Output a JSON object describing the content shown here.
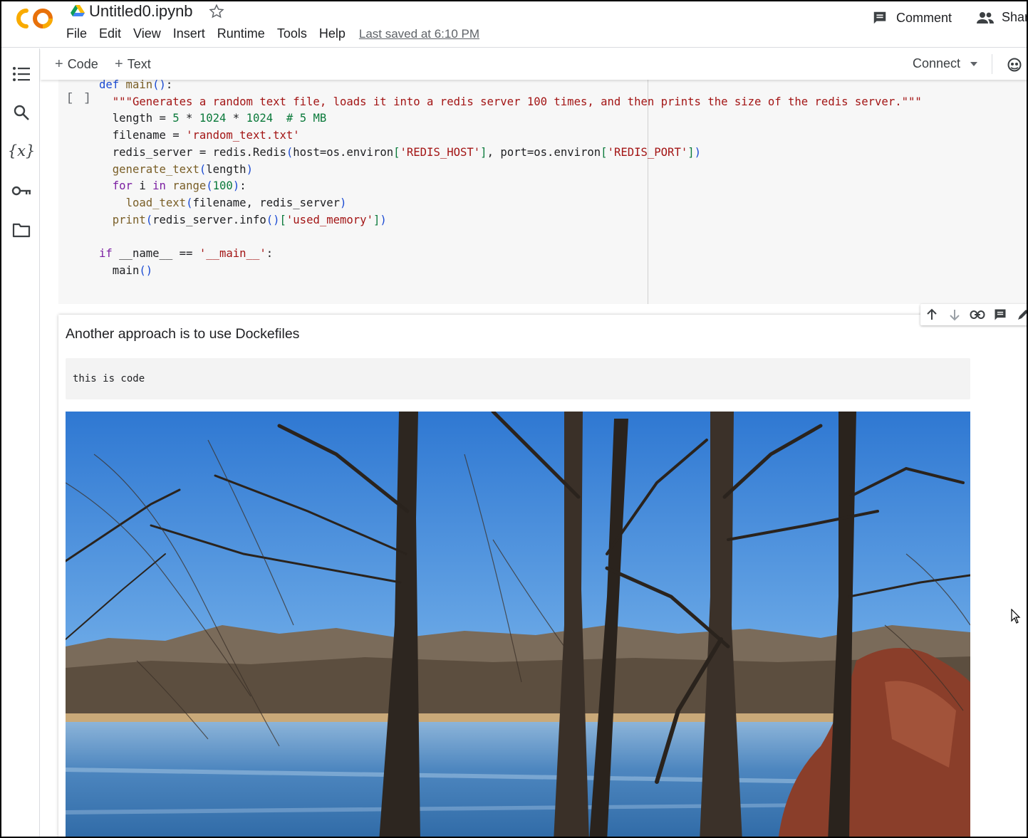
{
  "header": {
    "doc_title": "Untitled0.ipynb",
    "menu": [
      "File",
      "Edit",
      "View",
      "Insert",
      "Runtime",
      "Tools",
      "Help"
    ],
    "last_saved": "Last saved at 6:10 PM",
    "comment_label": "Comment",
    "share_label": "Share"
  },
  "sidebar": {
    "items": [
      "table-of-contents-icon",
      "search-icon",
      "variables-icon",
      "secrets-key-icon",
      "files-folder-icon"
    ]
  },
  "toolbar": {
    "add_code": "Code",
    "add_text": "Text",
    "connect": "Connect"
  },
  "code_cell": {
    "exec_indicator": "[ ]",
    "lines": {
      "l0_kw": "def",
      "l0_name": " main",
      "l0_paren": "()",
      "l0_colon": ":",
      "l1_str": "\"\"\"Generates a random text file, loads it into a redis server 100 times, and then prints the size of the redis server.\"\"\"",
      "l2_a": "length = ",
      "l2_n1": "5",
      "l2_b": " * ",
      "l2_n2": "1024",
      "l2_c": " * ",
      "l2_n3": "1024",
      "l2_cmt": "  # 5 MB",
      "l3_a": "filename = ",
      "l3_str": "'random_text.txt'",
      "l4_a": "redis_server = redis.Redis",
      "l4_p1": "(",
      "l4_b": "host=os.environ",
      "l4_br1": "[",
      "l4_s1": "'REDIS_HOST'",
      "l4_br2": "]",
      "l4_c": ", port=os.environ",
      "l4_br3": "[",
      "l4_s2": "'REDIS_PORT'",
      "l4_br4": "]",
      "l4_p2": ")",
      "l5_fn": "generate_text",
      "l5_p1": "(",
      "l5_a": "length",
      "l5_p2": ")",
      "l6_for": "for",
      "l6_a": " i ",
      "l6_in": "in",
      "l6_sp": " ",
      "l6_fn": "range",
      "l6_p1": "(",
      "l6_n": "100",
      "l6_p2": ")",
      "l6_colon": ":",
      "l7_fn": "load_text",
      "l7_p1": "(",
      "l7_a": "filename, redis_server",
      "l7_p2": ")",
      "l8_fn": "print",
      "l8_p1": "(",
      "l8_a": "redis_server.info",
      "l8_p2": "()",
      "l8_br1": "[",
      "l8_s": "'used_memory'",
      "l8_br2": "]",
      "l8_p3": ")",
      "l10_if": "if",
      "l10_a": " __name__ == ",
      "l10_s": "'__main__'",
      "l10_colon": ":",
      "l11_a": "main",
      "l11_p": "()"
    }
  },
  "text_cell": {
    "heading": "Another approach is to use Dockefiles",
    "code_block": "this is code"
  },
  "colors": {
    "accent_orange": "#f9ab00",
    "keyword_purple": "#7b1fa2",
    "string_red": "#a31515",
    "number_green": "#0b7a3b",
    "sky_blue": "#4a8fdc"
  }
}
